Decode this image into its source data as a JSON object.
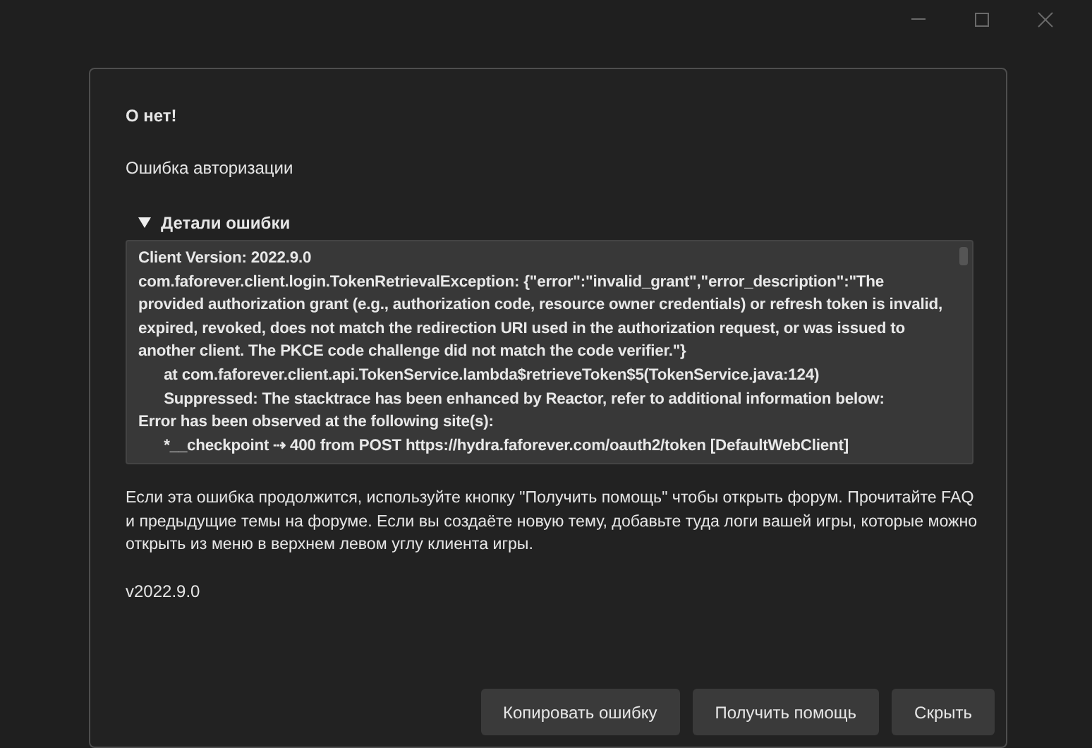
{
  "window_controls": [
    {
      "kind": "minimize"
    },
    {
      "kind": "maximize"
    },
    {
      "kind": "close"
    }
  ],
  "dialog": {
    "title": "О нет!",
    "message": "Ошибка авторизации",
    "details": {
      "label": "Детали ошибки",
      "expanded": true,
      "text": "Client Version: 2022.9.0\ncom.faforever.client.login.TokenRetrievalException: {\"error\":\"invalid_grant\",\"error_description\":\"The provided authorization grant (e.g., authorization code, resource owner credentials) or refresh token is invalid, expired, revoked, does not match the redirection URI used in the authorization request, or was issued to another client. The PKCE code challenge did not match the code verifier.\"}\n\tat com.faforever.client.api.TokenService.lambda$retrieveToken$5(TokenService.java:124)\n\tSuppressed: The stacktrace has been enhanced by Reactor, refer to additional information below:\nError has been observed at the following site(s):\n\t*__checkpoint ⇢ 400 from POST https://hydra.faforever.com/oauth2/token [DefaultWebClient]"
    },
    "help_text": "Если эта ошибка продолжится, используйте кнопку \"Получить помощь\" чтобы открыть форум. Прочитайте FAQ и предыдущие темы на форуме. Если вы создаёте новую тему, добавьте туда логи вашей игры, которые можно открыть из меню в верхнем левом углу клиента игры.",
    "version": "v2022.9.0",
    "buttons": [
      "Копировать ошибку",
      "Получить помощь",
      "Скрыть"
    ]
  }
}
